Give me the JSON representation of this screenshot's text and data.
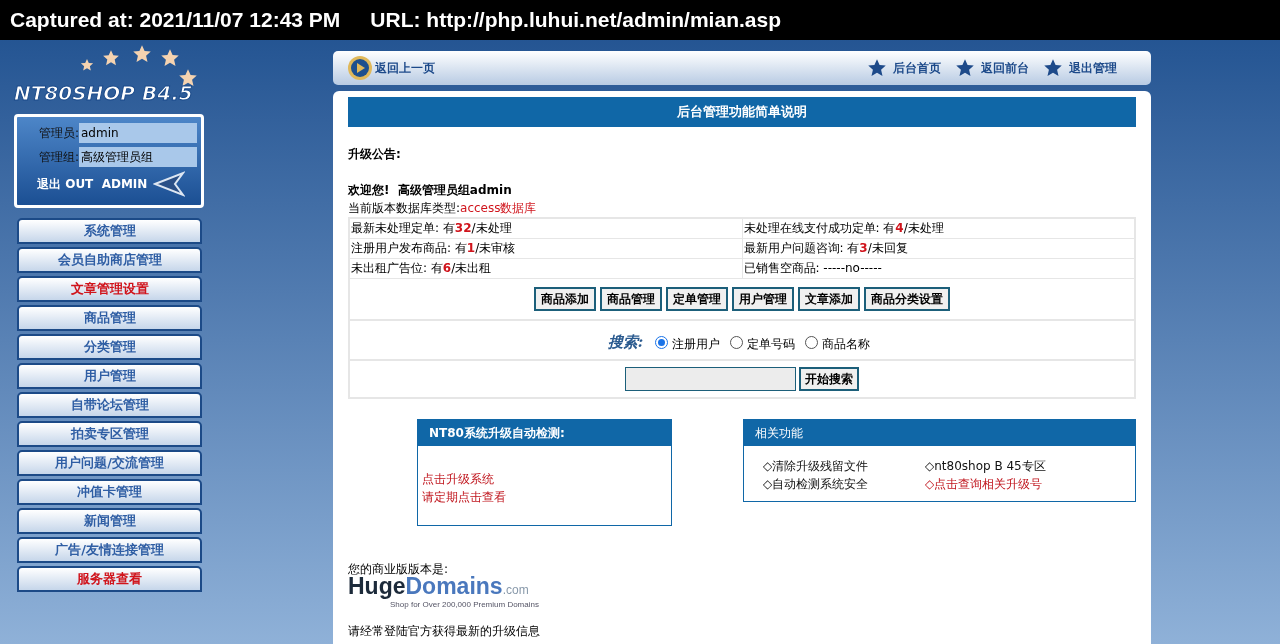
{
  "capture_bar": {
    "captured": "Captured at: 2021/11/07 12:43 PM",
    "url": "URL: http://php.luhui.net/admin/mian.asp"
  },
  "sidebar": {
    "logo": "NT80SHOP B4.5",
    "admin_box": {
      "admin_label": "管理员:",
      "admin_value": "admin",
      "group_label": "管理组:",
      "group_value": "高级管理员组",
      "logout": "退出 OUT  ADMIN"
    },
    "menu": [
      {
        "label": "系统管理",
        "highlighted": false
      },
      {
        "label": "会员自助商店管理",
        "highlighted": false
      },
      {
        "label": "文章管理设置",
        "highlighted": true
      },
      {
        "label": "商品管理",
        "highlighted": false
      },
      {
        "label": "分类管理",
        "highlighted": false
      },
      {
        "label": "用户管理",
        "highlighted": false
      },
      {
        "label": "自带论坛管理",
        "highlighted": false
      },
      {
        "label": "拍卖专区管理",
        "highlighted": false
      },
      {
        "label": "用户问题/交流管理",
        "highlighted": false
      },
      {
        "label": "冲值卡管理",
        "highlighted": false
      },
      {
        "label": "新闻管理",
        "highlighted": false
      },
      {
        "label": "广告/友情连接管理",
        "highlighted": false
      },
      {
        "label": "服务器查看",
        "highlighted": true
      }
    ]
  },
  "top_nav": {
    "back": "返回上一页",
    "links": [
      "后台首页",
      "返回前台",
      "退出管理"
    ]
  },
  "main": {
    "title": "后台管理功能简单说明",
    "notice": "升级公告:",
    "welcome": "欢迎您!  高级管理员组admin",
    "db_label": "当前版本数据库类型: ",
    "db_value": "access数据库",
    "stats": [
      [
        "最新未处理定单: 有**32**/未处理",
        "未处理在线支付成功定单: 有**4**/未处理"
      ],
      [
        "注册用户发布商品: 有**1**/未审核",
        "最新用户问题咨询: 有**3**/未回复"
      ],
      [
        "未出租广告位: 有**6**/未出租",
        "已销售空商品: -----no-----"
      ]
    ],
    "buttons": [
      "商品添加",
      "商品管理",
      "定单管理",
      "用户管理",
      "文章添加",
      "商品分类设置"
    ],
    "search": {
      "label": "搜索:",
      "options": [
        {
          "label": "注册用户",
          "selected": true
        },
        {
          "label": "定单号码",
          "selected": false
        },
        {
          "label": "商品名称",
          "selected": false
        }
      ],
      "button": "开始搜索"
    },
    "upgrade_panel": {
      "title": "NT80系统升级自动检测:",
      "links": [
        "点击升级系统",
        "请定期点击查看"
      ]
    },
    "related_panel": {
      "title": "相关功能",
      "items": [
        {
          "label": "◇清除升级残留文件",
          "highlighted": false
        },
        {
          "label": "◇nt80shop B 45专区",
          "highlighted": false
        },
        {
          "label": "◇自动检测系统安全",
          "highlighted": false
        },
        {
          "label": "◇点击查询相关升级号",
          "highlighted": true
        }
      ]
    },
    "version_label": "您的商业版版本是:",
    "version_logo": {
      "huge": "Huge",
      "domains": "Domains",
      "com": ".com",
      "tagline": "Shop for Over 200,000 Premium Domains"
    },
    "footer_note": "请经常登陆官方获得最新的升级信息"
  }
}
